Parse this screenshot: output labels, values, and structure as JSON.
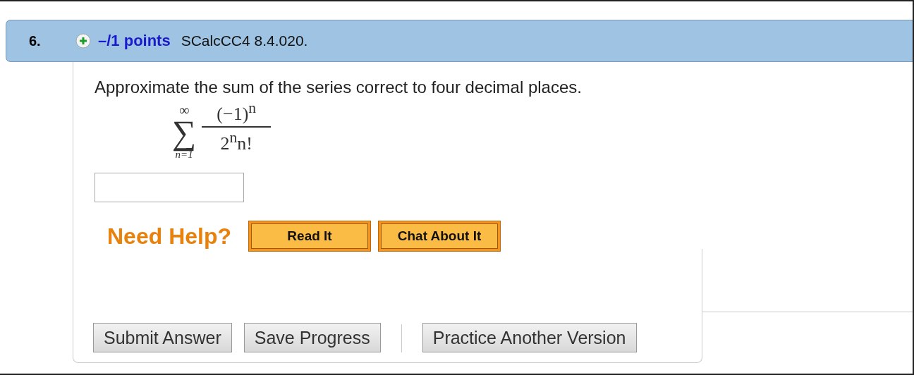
{
  "question": {
    "number": "6.",
    "points": "–/1 points",
    "source": "SCalcCC4 8.4.020."
  },
  "prompt": "Approximate the sum of the series correct to four decimal places.",
  "formula": {
    "sum_sign": "∑",
    "upper_limit": "∞",
    "lower_limit": "n=1",
    "numerator": "(−1)$^{n}$",
    "denominator": "2$^{n}$n!"
  },
  "help": {
    "label": "Need Help?",
    "buttons": [
      "Read It",
      "Chat About It"
    ]
  },
  "actions": {
    "left": [
      "Submit Answer",
      "Save Progress"
    ],
    "right": [
      "Practice Another Version"
    ]
  }
}
